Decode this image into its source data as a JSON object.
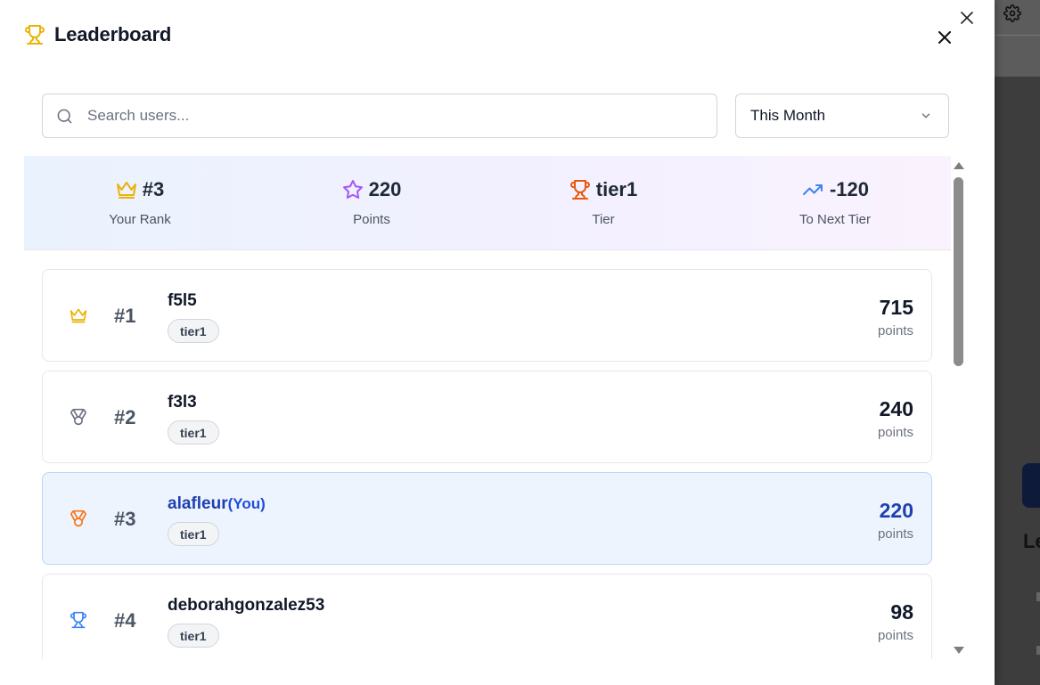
{
  "dialog": {
    "title": "Leaderboard",
    "search_placeholder": "Search users...",
    "period_selected": "This Month"
  },
  "stats": [
    {
      "icon": "crown-icon",
      "value": "#3",
      "label": "Your Rank",
      "color": "#eab308"
    },
    {
      "icon": "star-icon",
      "value": "220",
      "label": "Points",
      "color": "#a855f7"
    },
    {
      "icon": "trophy-icon",
      "value": "tier1",
      "label": "Tier",
      "color": "#ea580c"
    },
    {
      "icon": "trending-up-icon",
      "value": "-120",
      "label": "To Next Tier",
      "color": "#3b82f6"
    }
  ],
  "entries": [
    {
      "rank": "#1",
      "name": "f5l5",
      "you": "",
      "tier": "tier1",
      "points": "715",
      "points_label": "points",
      "icon": "crown-icon"
    },
    {
      "rank": "#2",
      "name": "f3l3",
      "you": "",
      "tier": "tier1",
      "points": "240",
      "points_label": "points",
      "icon": "medal-icon"
    },
    {
      "rank": "#3",
      "name": "alafleur",
      "you": "(You)",
      "tier": "tier1",
      "points": "220",
      "points_label": "points",
      "icon": "medal-icon"
    },
    {
      "rank": "#4",
      "name": "deborahgonzalez53",
      "you": "",
      "tier": "tier1",
      "points": "98",
      "points_label": "points",
      "icon": "trophy-icon"
    }
  ],
  "background": {
    "heading_fragment": "Le"
  },
  "colors": {
    "gold": "#eab308",
    "silver": "#6b7280",
    "bronze": "#f97316",
    "blue": "#3b82f6",
    "highlight_bg": "#eef4fe"
  }
}
